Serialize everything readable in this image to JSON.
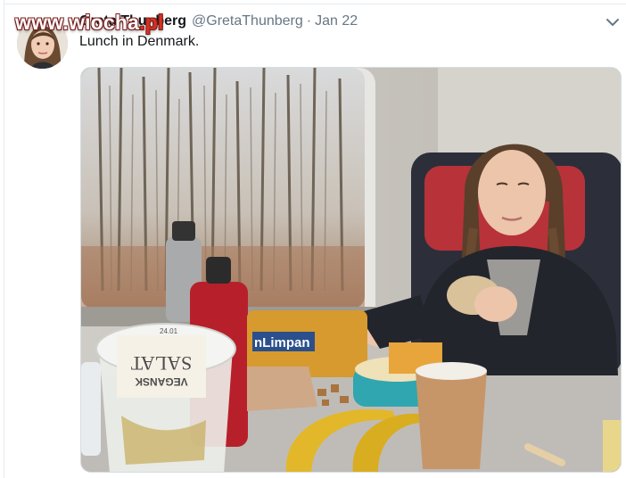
{
  "watermark": {
    "text_main": "www.wiocha",
    "text_accent": ".pl"
  },
  "tweet": {
    "display_name": "Greta Thunberg",
    "handle": "@GretaThunberg",
    "separator": "·",
    "date": "Jan 22",
    "text": "Lunch in Denmark."
  },
  "media": {
    "package_label_1": "VEGANSK",
    "package_label_2": "SALAT",
    "bread_label": "nLimpan",
    "small_label": "24.01"
  },
  "colors": {
    "text_primary": "#14171a",
    "text_secondary": "#657786",
    "border": "#e6ecf0"
  },
  "icons": {
    "caret": "chevron-down-icon"
  }
}
